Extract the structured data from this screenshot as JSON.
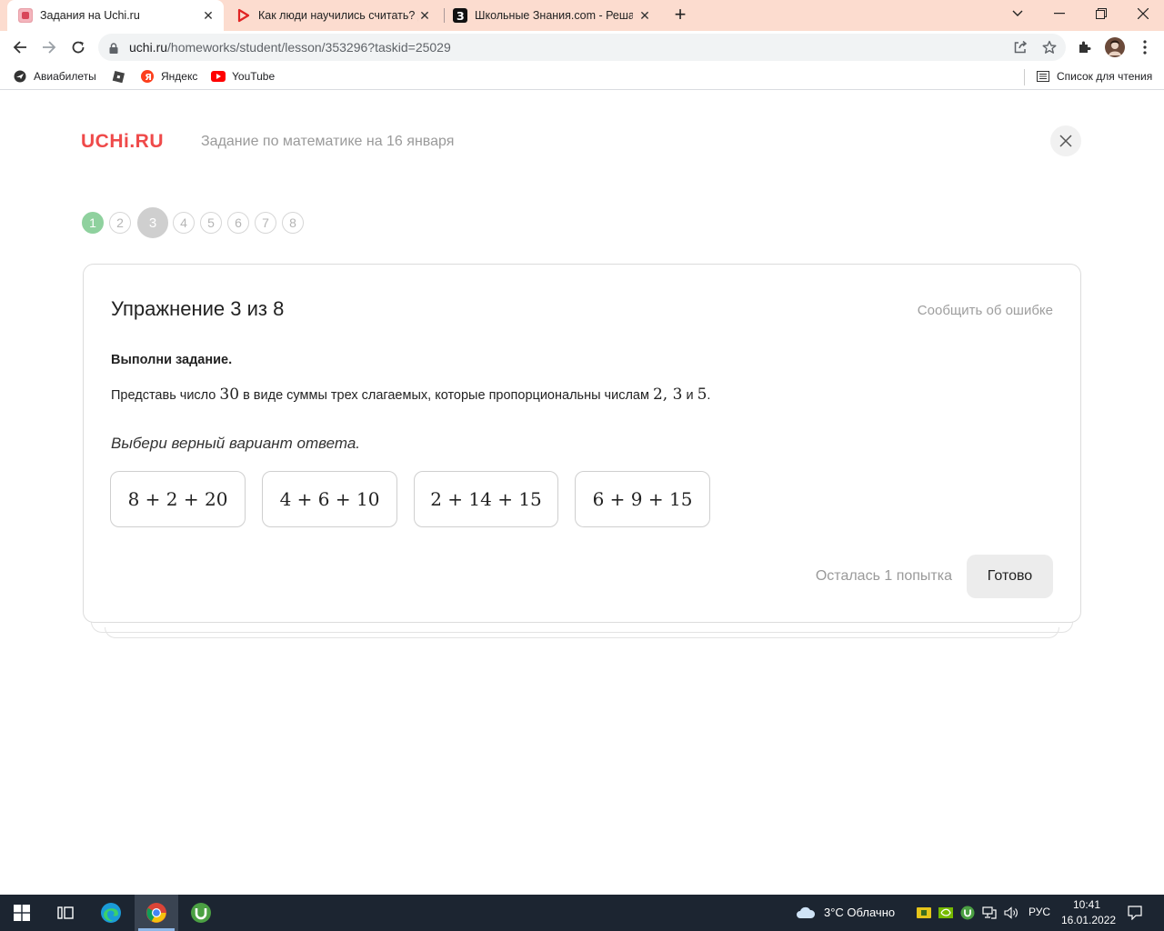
{
  "browser": {
    "tabs": [
      {
        "title": "Задания на Uchi.ru",
        "active": true,
        "favicon": "uchi-favicon-icon"
      },
      {
        "title": "Как люди научились считать? Д",
        "active": false,
        "favicon": "youtube-red-icon"
      },
      {
        "title": "Школьные Знания.com - Решае",
        "active": false,
        "favicon": "znania-icon"
      }
    ],
    "url_domain": "uchi.ru",
    "url_path": "/homeworks/student/lesson/353296?taskid=25029",
    "bookmarks": [
      {
        "label": "Авиабилеты",
        "icon": "plane-globe-icon"
      },
      {
        "label": "",
        "icon": "roblox-icon"
      },
      {
        "label": "Яндекс",
        "icon": "yandex-icon"
      },
      {
        "label": "YouTube",
        "icon": "youtube-icon"
      }
    ],
    "reading_list_label": "Список для чтения"
  },
  "page": {
    "logo": "UCHi.RU",
    "lesson_title": "Задание по математике на 16 января",
    "steps": [
      "1",
      "2",
      "3",
      "4",
      "5",
      "6",
      "7",
      "8"
    ],
    "current_step": 3,
    "done_steps": [
      1
    ],
    "exercise": {
      "title": "Упражнение 3 из 8",
      "report_label": "Сообщить об ошибке",
      "instruction": "Выполни задание.",
      "question_part1": "Представь число ",
      "question_num": "30",
      "question_part2": " в виде суммы трех слагаемых, которые пропорциональны числам ",
      "question_nums": "2, 3",
      "question_and": " и ",
      "question_last": "5",
      "question_end": ".",
      "hint": "Выбери верный вариант ответа.",
      "options": [
        "8 + 2 + 20",
        "4 + 6 + 10",
        "2 + 14 + 15",
        "6 + 9 + 15"
      ],
      "attempts_text": "Осталась 1 попытка",
      "submit_label": "Готово"
    }
  },
  "taskbar": {
    "weather": "3°C  Облачно",
    "language": "РУС",
    "time": "10:41",
    "date": "16.01.2022"
  },
  "colors": {
    "tabstrip": "#fcdccf",
    "brand_red": "#ef4a4a",
    "step_done": "#8fd19e",
    "taskbar": "#1c2531"
  }
}
